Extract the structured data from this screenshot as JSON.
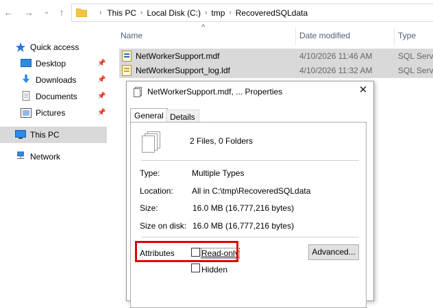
{
  "address_bar": {
    "crumbs": [
      "This PC",
      "Local Disk (C:)",
      "tmp",
      "RecoveredSQLdata"
    ]
  },
  "columns": {
    "name": "Name",
    "date_modified": "Date modified",
    "type": "Type"
  },
  "sidebar": {
    "items": [
      {
        "label": "Quick access",
        "icon": "star-icon"
      },
      {
        "label": "Desktop",
        "icon": "desktop-icon",
        "pinned": true
      },
      {
        "label": "Downloads",
        "icon": "download-icon",
        "pinned": true
      },
      {
        "label": "Documents",
        "icon": "documents-icon",
        "pinned": true
      },
      {
        "label": "Pictures",
        "icon": "pictures-icon",
        "pinned": true
      },
      {
        "label": "This PC",
        "icon": "computer-icon",
        "selected": true
      },
      {
        "label": "Network",
        "icon": "network-icon"
      }
    ]
  },
  "files": [
    {
      "name": "NetWorkerSupport.mdf",
      "date": "4/10/2026 11:46 AM",
      "type": "SQL Serve"
    },
    {
      "name": "NetWorkerSupport_log.ldf",
      "date": "4/10/2026 11:32 AM",
      "type": "SQL Serve"
    }
  ],
  "dialog": {
    "title": "NetWorkerSupport.mdf, ... Properties",
    "tabs": [
      "General",
      "Details"
    ],
    "summary": "2 Files, 0 Folders",
    "type_label": "Type:",
    "type_value": "Multiple Types",
    "location_label": "Location:",
    "location_value": "All in C:\\tmp\\RecoveredSQLdata",
    "size_label": "Size:",
    "size_value": "16.0 MB (16,777,216 bytes)",
    "size_on_disk_label": "Size on disk:",
    "size_on_disk_value": "16.0 MB (16,777,216 bytes)",
    "attributes_label": "Attributes",
    "readonly_label": "Read-only",
    "hidden_label": "Hidden",
    "advanced_label": "Advanced...",
    "close_glyph": "✕"
  },
  "colors": {
    "highlight": "#e00000",
    "selection": "#d9d9d9",
    "folder": "#f4c542"
  }
}
